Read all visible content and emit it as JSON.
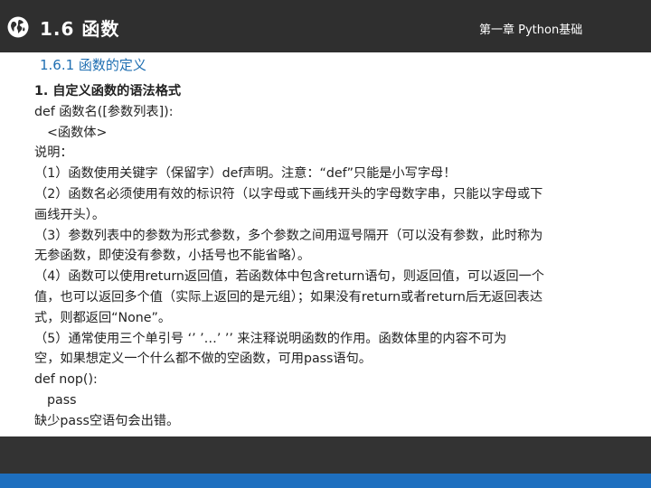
{
  "header": {
    "title": "1.6  函数",
    "chapter": "第一章 Python基础",
    "icon": "globe-icon"
  },
  "section_title": "1.6.1  函数的定义",
  "content": {
    "heading": "1. 自定义函数的语法格式",
    "lines": [
      "def 函数名([参数列表]):",
      "<函数体>",
      "说明：",
      "（1）函数使用关键字（保留字）def声明。注意：“def”只能是小写字母！",
      "（2）函数名必须使用有效的标识符（以字母或下画线开头的字母数字串，只能以字母或下",
      "画线开头）。",
      "（3）参数列表中的参数为形式参数，多个参数之间用逗号隔开（可以没有参数，此时称为",
      "无参函数，即使没有参数，小括号也不能省略）。",
      "（4）函数可以使用return返回值，若函数体中包含return语句，则返回值，可以返回一个",
      "值，也可以返回多个值（实际上返回的是元组）；如果没有return或者return后无返回表达",
      "式，则都返回“None”。",
      "（5）通常使用三个单引号 ‘’ ’…’ ’’ 来注释说明函数的作用。函数体里的内容不可为",
      "空，如果想定义一个什么都不做的空函数，可用pass语句。",
      "def nop():",
      "pass",
      "缺少pass空语句会出错。"
    ]
  },
  "colors": {
    "header_bg": "#2f2f2f",
    "section_title": "#1f6fb2",
    "footer_dark": "#333333",
    "footer_blue": "#1e6fbf"
  }
}
